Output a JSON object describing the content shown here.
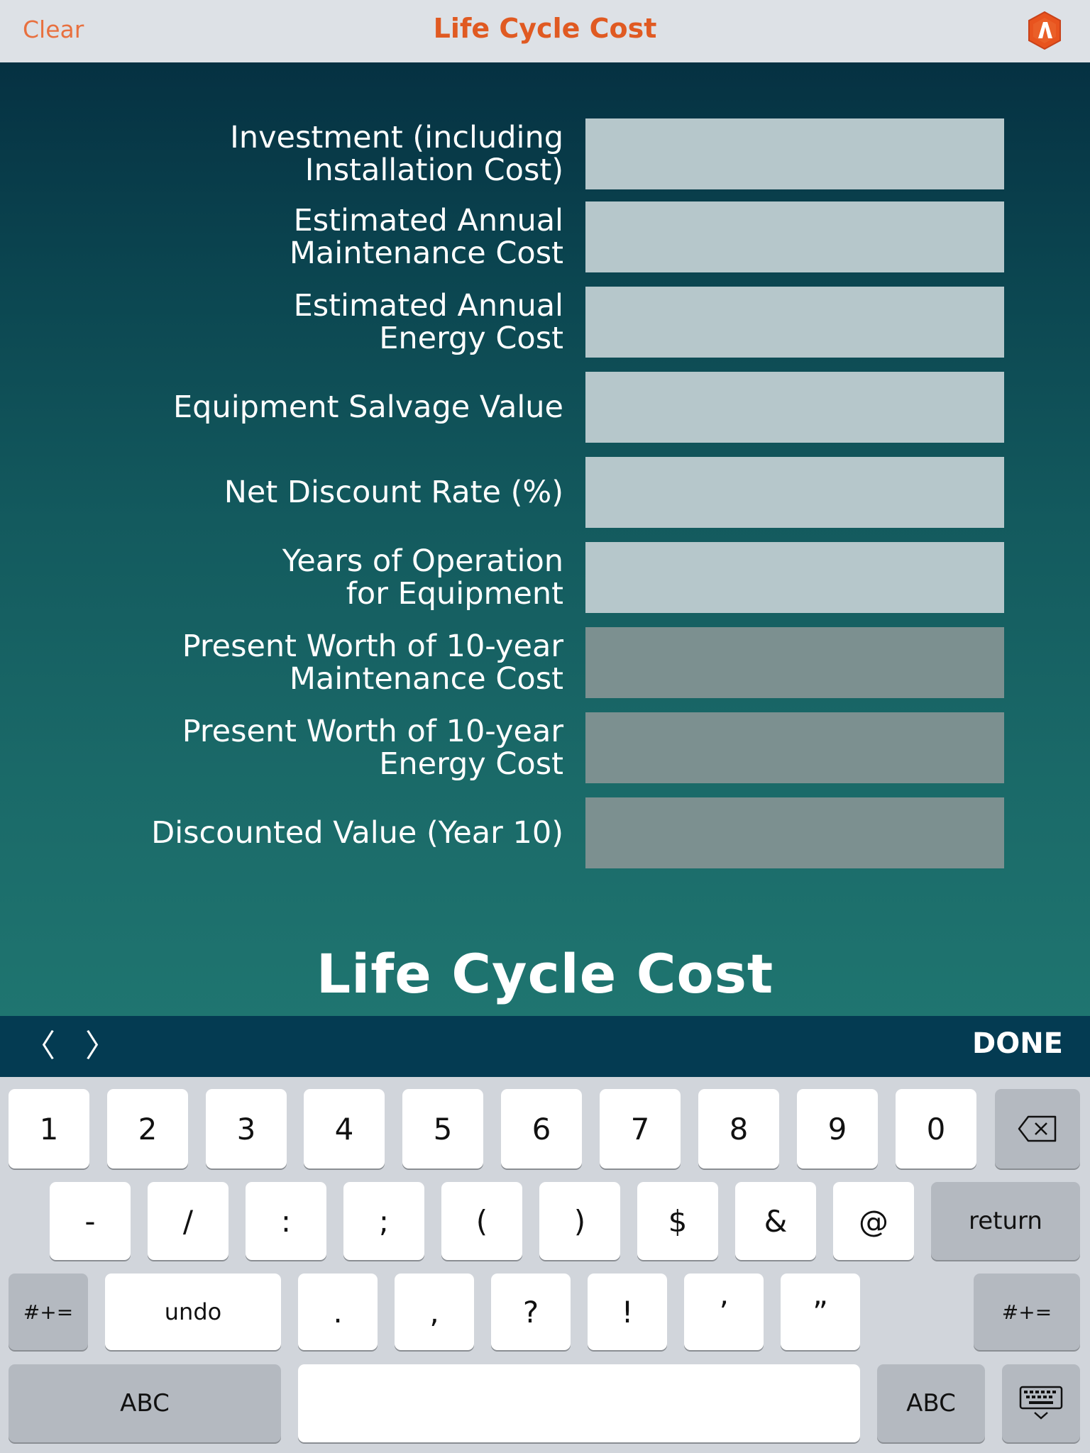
{
  "navbar": {
    "clear_label": "Clear",
    "title": "Life Cycle Cost",
    "logo_icon": "app-logo-icon",
    "accent_color": "#e05a22"
  },
  "form": {
    "rows": [
      {
        "label": "Investment (including\nInstallation Cost)",
        "value": "",
        "kind": "input"
      },
      {
        "label": "Estimated Annual\nMaintenance Cost",
        "value": "",
        "kind": "input"
      },
      {
        "label": "Estimated Annual\nEnergy Cost",
        "value": "",
        "kind": "input"
      },
      {
        "label": "Equipment Salvage Value",
        "value": "",
        "kind": "input"
      },
      {
        "label": "Net Discount Rate (%)",
        "value": "",
        "kind": "input"
      },
      {
        "label": "Years of Operation\nfor Equipment",
        "value": "",
        "kind": "input"
      },
      {
        "label": "Present Worth of 10-year\nMaintenance Cost",
        "value": "",
        "kind": "output"
      },
      {
        "label": "Present Worth of 10-year\nEnergy Cost",
        "value": "",
        "kind": "output"
      },
      {
        "label": "Discounted Value (Year 10)",
        "value": "",
        "kind": "output"
      }
    ]
  },
  "big_title": "Life Cycle Cost",
  "accessory": {
    "prev_icon": "chevron-left-icon",
    "prev_glyph": "〈",
    "next_icon": "chevron-right-icon",
    "next_glyph": "〉",
    "done_label": "DONE"
  },
  "keyboard": {
    "row1": [
      "1",
      "2",
      "3",
      "4",
      "5",
      "6",
      "7",
      "8",
      "9",
      "0"
    ],
    "delete_icon": "backspace-icon",
    "row2": [
      "-",
      "/",
      ":",
      ";",
      "(",
      ")",
      "$",
      "&",
      "@"
    ],
    "return_label": "return",
    "row3": {
      "shift_left": "#+=",
      "undo": "undo",
      "keys": [
        ".",
        ",",
        "?",
        "!",
        "’",
        "”"
      ],
      "shift_right": "#+="
    },
    "row4": {
      "abc_left": "ABC",
      "space": "",
      "abc_right": "ABC",
      "dismiss_icon": "keyboard-dismiss-icon"
    }
  }
}
